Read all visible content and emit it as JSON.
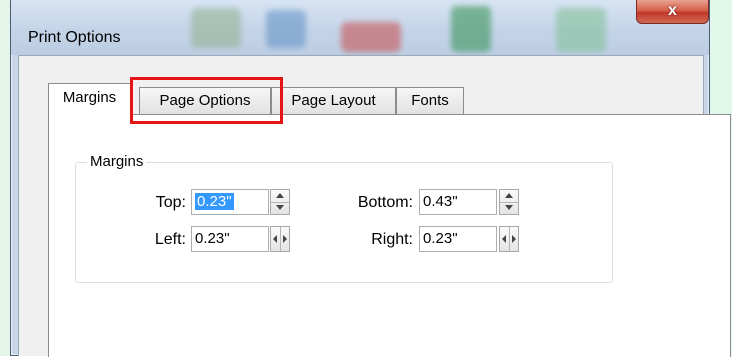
{
  "window": {
    "title": "Print Options",
    "close_label": "x"
  },
  "tabs": [
    {
      "label": "Margins",
      "active": true
    },
    {
      "label": "Page Options",
      "active": false,
      "highlighted": true
    },
    {
      "label": "Page Layout",
      "active": false
    },
    {
      "label": "Fonts",
      "active": false
    }
  ],
  "margins": {
    "group_label": "Margins",
    "top": {
      "label": "Top:",
      "value": "0.23\""
    },
    "left": {
      "label": "Left:",
      "value": "0.23\""
    },
    "bottom": {
      "label": "Bottom:",
      "value": "0.43\""
    },
    "right": {
      "label": "Right:",
      "value": "0.23\""
    }
  },
  "colors": {
    "highlight": "#e51515",
    "selection": "#3399ff",
    "close_button": "#c1382a"
  }
}
